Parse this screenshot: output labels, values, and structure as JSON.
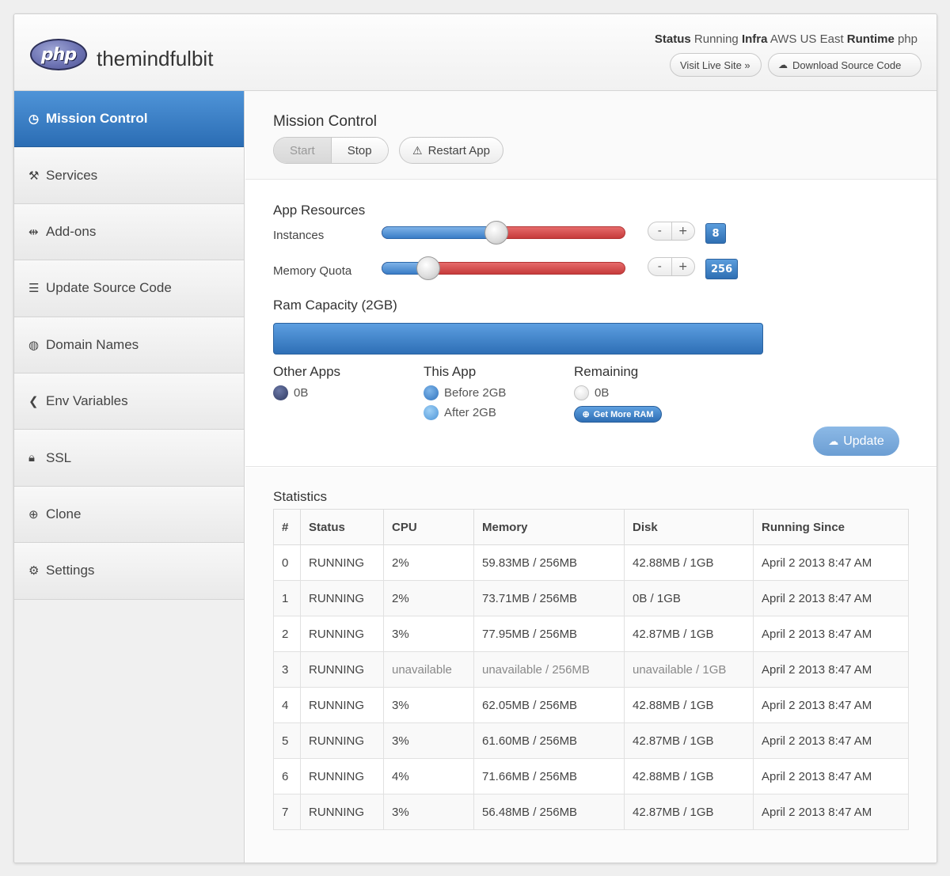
{
  "header": {
    "logo_text": "php",
    "app_name": "themindfulbit",
    "status_label": "Status",
    "status_value": "Running",
    "infra_label": "Infra",
    "infra_value": "AWS US East",
    "runtime_label": "Runtime",
    "runtime_value": "php",
    "visit_live_site": "Visit Live Site »",
    "download_source_code": "Download Source Code"
  },
  "sidebar": {
    "items": [
      {
        "label": "Mission Control",
        "icon": "dashboard-icon",
        "active": true
      },
      {
        "label": "Services",
        "icon": "tools-icon"
      },
      {
        "label": "Add-ons",
        "icon": "plug-icon"
      },
      {
        "label": "Update Source Code",
        "icon": "list-icon"
      },
      {
        "label": "Domain Names",
        "icon": "globe-icon"
      },
      {
        "label": "Env Variables",
        "icon": "chevron-left-icon"
      },
      {
        "label": "SSL",
        "icon": "lock-icon"
      },
      {
        "label": "Clone",
        "icon": "plus-circle-icon"
      },
      {
        "label": "Settings",
        "icon": "gear-icon"
      }
    ]
  },
  "mission_control": {
    "title": "Mission Control",
    "start": "Start",
    "stop": "Stop",
    "restart": "Restart App"
  },
  "resources": {
    "title": "App Resources",
    "instances_label": "Instances",
    "instances_value": "8",
    "instances_fraction": 0.47,
    "memory_label": "Memory Quota",
    "memory_value": "256",
    "memory_fraction": 0.19,
    "minus": "-",
    "plus": "+"
  },
  "ram": {
    "title": "Ram Capacity (2GB)",
    "other_apps_title": "Other Apps",
    "other_apps_value": "0B",
    "this_app_title": "This App",
    "before": "Before 2GB",
    "after": "After 2GB",
    "remaining_title": "Remaining",
    "remaining_value": "0B",
    "get_more": "Get More RAM",
    "update": "Update"
  },
  "statistics": {
    "title": "Statistics",
    "columns": [
      "#",
      "Status",
      "CPU",
      "Memory",
      "Disk",
      "Running Since"
    ],
    "rows": [
      [
        "0",
        "RUNNING",
        "2%",
        "59.83MB / 256MB",
        "42.88MB / 1GB",
        "April 2 2013 8:47 AM"
      ],
      [
        "1",
        "RUNNING",
        "2%",
        "73.71MB / 256MB",
        "0B / 1GB",
        "April 2 2013 8:47 AM"
      ],
      [
        "2",
        "RUNNING",
        "3%",
        "77.95MB / 256MB",
        "42.87MB / 1GB",
        "April 2 2013 8:47 AM"
      ],
      [
        "3",
        "RUNNING",
        "unavailable",
        "unavailable / 256MB",
        "unavailable / 1GB",
        "April 2 2013 8:47 AM"
      ],
      [
        "4",
        "RUNNING",
        "3%",
        "62.05MB / 256MB",
        "42.88MB / 1GB",
        "April 2 2013 8:47 AM"
      ],
      [
        "5",
        "RUNNING",
        "3%",
        "61.60MB / 256MB",
        "42.87MB / 1GB",
        "April 2 2013 8:47 AM"
      ],
      [
        "6",
        "RUNNING",
        "4%",
        "71.66MB / 256MB",
        "42.88MB / 1GB",
        "April 2 2013 8:47 AM"
      ],
      [
        "7",
        "RUNNING",
        "3%",
        "56.48MB / 256MB",
        "42.87MB / 1GB",
        "April 2 2013 8:47 AM"
      ]
    ]
  },
  "colors": {
    "accent_blue": "#2b6db4",
    "slider_red": "#c63b3b"
  }
}
